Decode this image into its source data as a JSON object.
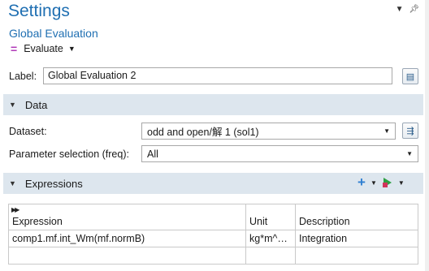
{
  "header": {
    "title": "Settings",
    "subtitle": "Global Evaluation",
    "evaluate_label": "Evaluate"
  },
  "label_row": {
    "label": "Label:",
    "value": "Global Evaluation 2"
  },
  "data_section": {
    "title": "Data",
    "dataset_label": "Dataset:",
    "dataset_value": "odd and open/解 1 (sol1)",
    "param_label": "Parameter selection (freq):",
    "param_value": "All"
  },
  "expressions_section": {
    "title": "Expressions",
    "columns": [
      "Expression",
      "Unit",
      "Description"
    ],
    "rows": [
      [
        "comp1.mf.int_Wm(mf.normB)",
        "kg*m^…",
        "Integration"
      ],
      [
        "",
        "",
        ""
      ]
    ]
  },
  "colors": {
    "accent": "#1f6fb2",
    "section_bg": "#dde6ee",
    "evaluate_icon": "#b03ab8",
    "add_icon": "#2f7fd1"
  },
  "icons": [
    "chevron-down-icon",
    "pin-icon",
    "evaluate-icon",
    "label-edit-icon",
    "dataset-goto-icon",
    "add-icon",
    "evaluate-run-icon"
  ]
}
